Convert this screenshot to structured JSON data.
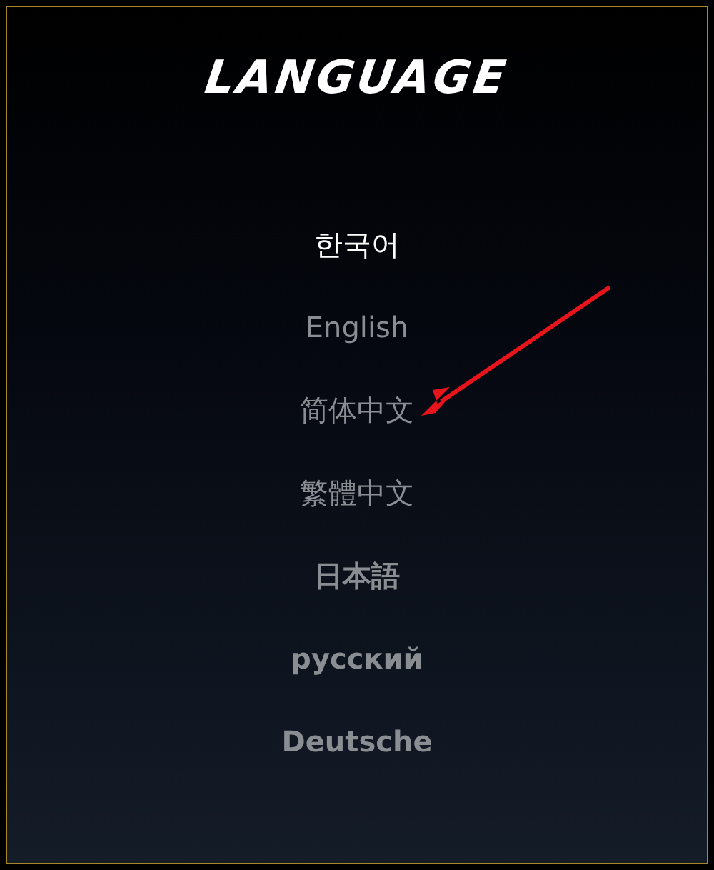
{
  "title": "LANGUAGE",
  "languages": [
    {
      "label": "한국어",
      "selected": true,
      "bold": false
    },
    {
      "label": "English",
      "selected": false,
      "bold": false
    },
    {
      "label": "简体中文",
      "selected": false,
      "bold": false
    },
    {
      "label": "繁體中文",
      "selected": false,
      "bold": false
    },
    {
      "label": "日本語",
      "selected": false,
      "bold": true
    },
    {
      "label": "русский",
      "selected": false,
      "bold": true
    },
    {
      "label": "Deutsche",
      "selected": false,
      "bold": true
    }
  ],
  "annotation": {
    "kind": "arrow"
  }
}
